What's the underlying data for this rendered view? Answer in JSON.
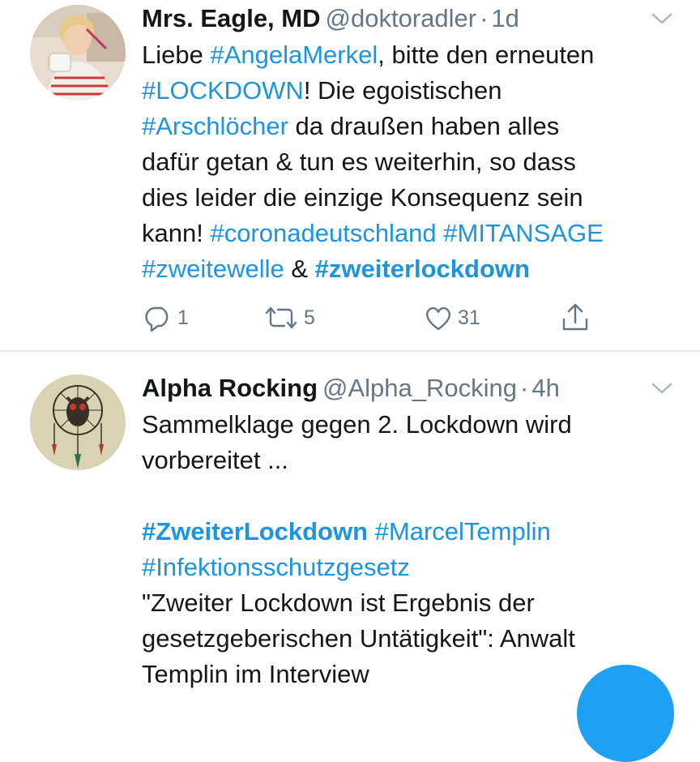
{
  "tweets": [
    {
      "display_name": "Mrs. Eagle, MD",
      "handle": "@doktoradler",
      "separator": "·",
      "time": "1d",
      "text": {
        "l1_a": "Liebe ",
        "l1_tag": "#AngelaMerkel",
        "l1_b": ", bitte den erneuten",
        "l2_tag": "#LOCKDOWN",
        "l2_b": "! Die egoistischen",
        "l3_tag": "#Arschlöcher",
        "l3_b": " da draußen haben alles",
        "l4": "dafür getan & tun es weiterhin, so dass",
        "l5": "dies leider die einzige Konsequenz sein",
        "l6_a": "kann! ",
        "l6_tag1": "#coronadeutschland",
        "l6_sp": " ",
        "l6_tag2": "#MITANSAGE",
        "l7_tag1": "#zweitewelle",
        "l7_mid": " & ",
        "l7_tag2": "#zweiterlockdown"
      },
      "replies": "1",
      "retweets": "5",
      "likes": "31"
    },
    {
      "display_name": "Alpha Rocking",
      "handle": "@Alpha_Rocking",
      "separator": "·",
      "time": "4h",
      "text": {
        "l1": "Sammelklage gegen 2. Lockdown wird",
        "l2": "vorbereitet ...",
        "l4_tag1": "#ZweiterLockdown",
        "l4_sp": " ",
        "l4_tag2": "#MarcelTemplin",
        "l5_tag": "#Infektionsschutzgesetz",
        "l6": "\"Zweiter Lockdown ist Ergebnis der",
        "l7": "gesetzgeberischen Untätigkeit\": Anwalt",
        "l8": "Templin im Interview"
      }
    }
  ],
  "icons": {
    "reply": "reply-icon",
    "retweet": "retweet-icon",
    "like": "heart-icon",
    "share": "share-icon",
    "menu": "chevron-down-icon",
    "compose": "compose-button"
  },
  "colors": {
    "link": "#1b95e0",
    "secondary_text": "#657786",
    "primary_text": "#14171a",
    "divider": "#e1e8ed",
    "fab": "#1da1f2"
  }
}
